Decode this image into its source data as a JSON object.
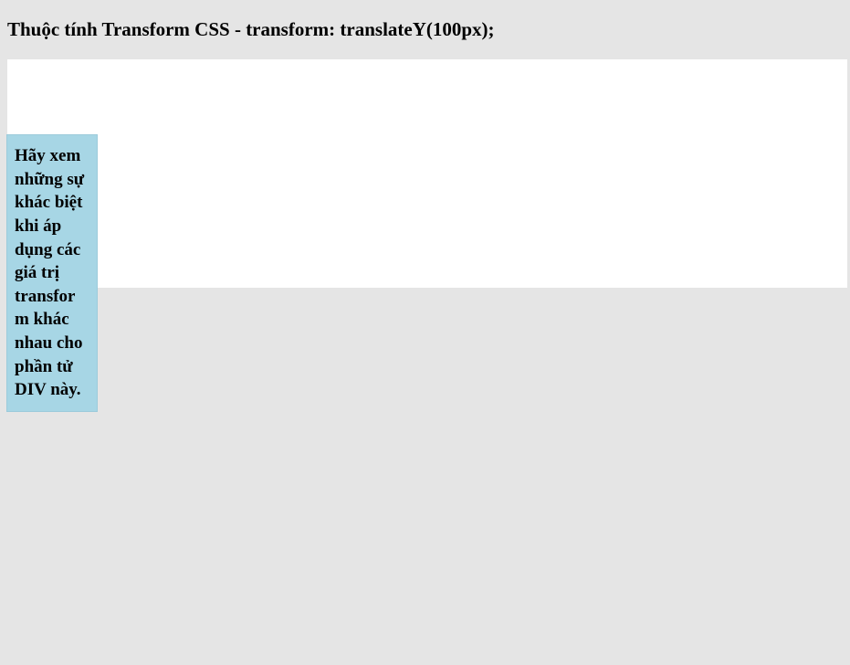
{
  "heading": "Thuộc tính Transform CSS - transform: translateY(100px);",
  "demo_text": "Hãy xem những sự khác biệt khi áp dụng các giá trị transform khác nhau cho phần tử DIV này."
}
